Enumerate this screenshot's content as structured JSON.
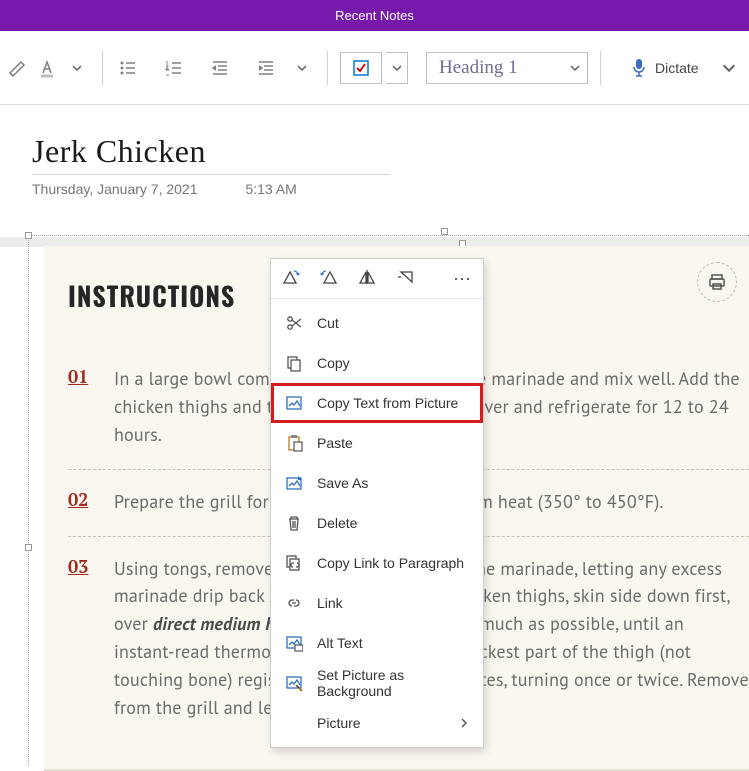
{
  "titlebar": {
    "text": "Recent Notes"
  },
  "ribbon": {
    "style_select": "Heading 1",
    "dictate_label": "Dictate"
  },
  "page": {
    "title": "Jerk Chicken",
    "date": "Thursday, January 7, 2021",
    "time": "5:13 AM"
  },
  "recipe": {
    "heading": "INSTRUCTIONS",
    "steps": [
      {
        "num": "01",
        "text": "In a large bowl combine the ingredients for the marinade and mix well. Add the chicken thighs and turn to coat in marinade. Cover and refrigerate for 12 to 24 hours."
      },
      {
        "num": "02",
        "text": "Prepare the grill for direct cooking over medium heat (350° to 450°F)."
      },
      {
        "num": "03",
        "html": "Using tongs, remove the chicken thighs from the marinade, letting any excess marinade drip back into the bowl. Grill the chicken thighs, skin side down first, over <em>direct medium heat</em>, with the lid closed as much as possible, until an instant-read thermometer inserted into the thickest part of the thigh (not touching bone) registers 165°F, about 30 minutes, turning once or twice. Remove from the grill and let rest for 3 to 5 minutes."
      }
    ]
  },
  "mini_toolbar": {
    "more": "⋯"
  },
  "context_menu": {
    "items": [
      {
        "id": "cut",
        "label": "Cut",
        "icon": "scissors"
      },
      {
        "id": "copy",
        "label": "Copy",
        "icon": "copy"
      },
      {
        "id": "copy-text-pic",
        "label": "Copy Text from Picture",
        "icon": "copypic",
        "highlight": true
      },
      {
        "id": "paste",
        "label": "Paste",
        "icon": "paste"
      },
      {
        "id": "save-as",
        "label": "Save As",
        "icon": "saveas"
      },
      {
        "id": "delete",
        "label": "Delete",
        "icon": "trash"
      },
      {
        "id": "copy-link-para",
        "label": "Copy Link to Paragraph",
        "icon": "linkcopy"
      },
      {
        "id": "link",
        "label": "Link",
        "icon": "link"
      },
      {
        "id": "alt-text",
        "label": "Alt Text",
        "icon": "alttext"
      },
      {
        "id": "set-bg",
        "label": "Set Picture as Background",
        "icon": "setbg"
      },
      {
        "id": "picture-sub",
        "label": "Picture",
        "submenu": true
      }
    ]
  }
}
